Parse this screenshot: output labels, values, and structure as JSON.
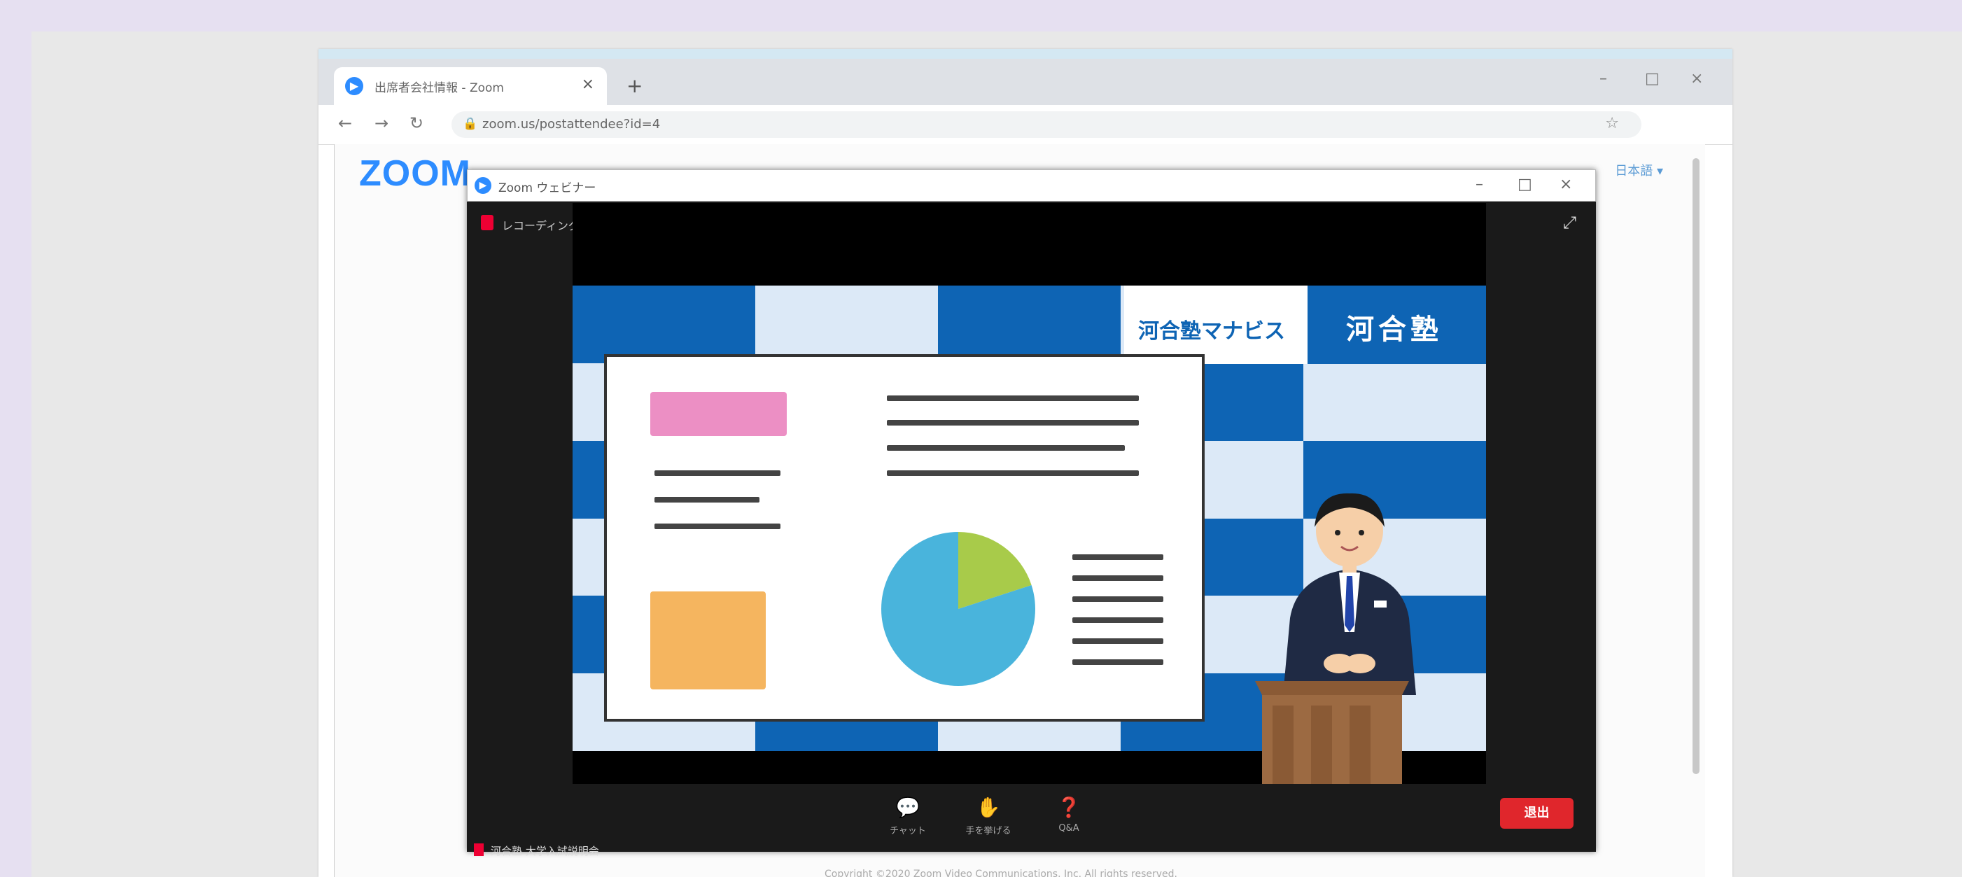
{
  "browser": {
    "tab_title": "出席者会社情報 - Zoom",
    "tab_close": "×",
    "new_tab": "+",
    "url": "zoom.us/postattendee?id=4",
    "window_controls": [
      "–",
      "□",
      "×"
    ]
  },
  "zoom_page": {
    "logo": "ZOOM",
    "language": "日本語 ▾",
    "footer": "Copyright ©2020 Zoom Video Communications, Inc. All rights reserved."
  },
  "webinar_window": {
    "title": "Zoom ウェビナー",
    "controls": [
      "–",
      "□",
      "×"
    ],
    "recording_label": "レコーディング",
    "brand_left": "河合塾マナビス",
    "brand_right": "河合塾",
    "toolbar": [
      {
        "icon": "chat-icon",
        "label": "チャット"
      },
      {
        "icon": "raise-hand-icon",
        "label": "手を挙げる"
      },
      {
        "icon": "qa-icon",
        "label": "Q&A"
      }
    ],
    "leave_button": "退出",
    "bottom_label": "河合塾 大学入試説明会"
  },
  "chart_data": {
    "type": "pie",
    "values": [
      0.2,
      0.8
    ]
  },
  "colors": {
    "zoom_blue": "#2d8cff",
    "stage_blue": "#0e64b4",
    "pink": "#ec8fc4",
    "orange": "#f5b55f",
    "pie_green": "#a8cb4a",
    "pie_blue": "#49b4dc",
    "leave_red": "#e0262c"
  }
}
